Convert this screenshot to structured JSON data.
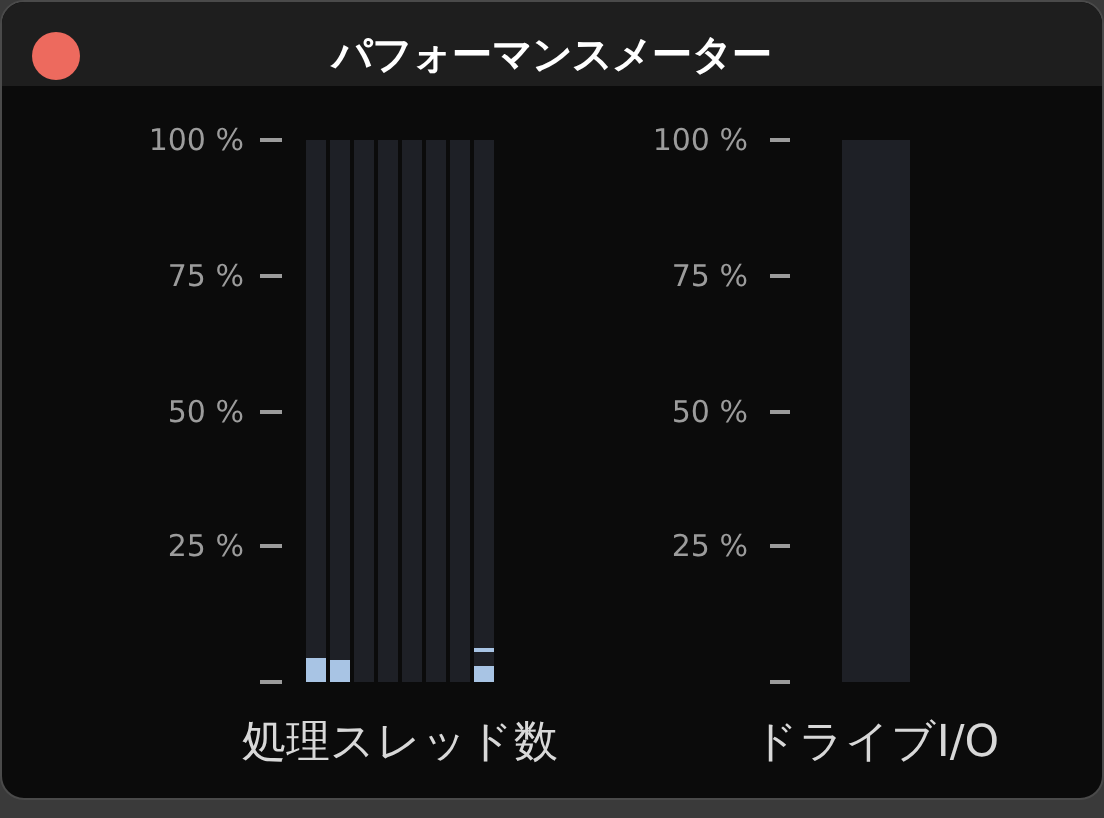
{
  "window": {
    "title": "パフォーマンスメーター"
  },
  "meters": [
    {
      "kind": "multi",
      "label": "処理スレッド数",
      "scale": [
        "100 %",
        "75 %",
        "50 %",
        "25 %"
      ],
      "tracks": [
        {
          "kind": "busy",
          "level": 0.045
        },
        {
          "kind": "busy",
          "level": 0.04
        },
        {
          "kind": "idle"
        },
        {
          "kind": "idle"
        },
        {
          "kind": "idle"
        },
        {
          "kind": "idle"
        },
        {
          "kind": "idle"
        },
        {
          "kind": "busy",
          "level": 0.03,
          "peak": {
            "level": 0.055
          }
        }
      ]
    },
    {
      "kind": "single",
      "label": "ドライブI/O",
      "scale": [
        "100 %",
        "75 %",
        "50 %",
        "25 %"
      ],
      "tracks": [
        {
          "kind": "idle"
        }
      ]
    }
  ]
}
